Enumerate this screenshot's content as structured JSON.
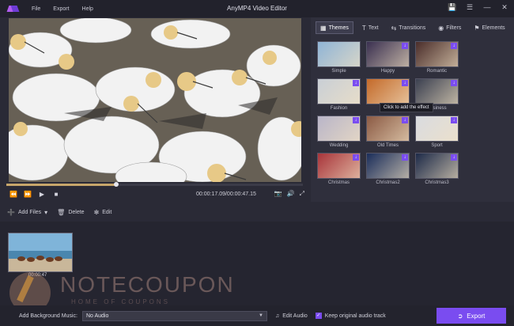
{
  "app": {
    "title": "AnyMP4 Video Editor",
    "menu": [
      "File",
      "Export",
      "Help"
    ],
    "window_controls": [
      "save-icon",
      "list-icon",
      "minimize-icon",
      "close-icon"
    ]
  },
  "player": {
    "time": "00:00:17.09/00:00:47.15",
    "progress": 0.37
  },
  "panel": {
    "tabs": [
      {
        "label": "Themes",
        "icon": "themes-icon",
        "active": true
      },
      {
        "label": "Text",
        "icon": "text-icon"
      },
      {
        "label": "Transitions",
        "icon": "transitions-icon"
      },
      {
        "label": "Filters",
        "icon": "filters-icon"
      },
      {
        "label": "Elements",
        "icon": "elements-icon"
      }
    ],
    "themes": [
      {
        "label": "Simple",
        "color": "#8fb4d6",
        "download": false
      },
      {
        "label": "Happy",
        "color": "#3a3050",
        "download": true
      },
      {
        "label": "Romantic",
        "color": "#4a2d2a",
        "download": true
      },
      {
        "label": "Fashion",
        "color": "#c9cfd6",
        "download": true
      },
      {
        "label": "",
        "color": "#c46a2a",
        "download": true
      },
      {
        "label": "Business",
        "color": "#3b4050",
        "download": true
      },
      {
        "label": "Wedding",
        "color": "#b9b5c8",
        "download": true
      },
      {
        "label": "Old Times",
        "color": "#8b5a44",
        "download": true
      },
      {
        "label": "Sport",
        "color": "#d9dbe0",
        "download": true
      },
      {
        "label": "Christmas",
        "color": "#a8343a",
        "download": true
      },
      {
        "label": "Christmas2",
        "color": "#1a2d5a",
        "download": true
      },
      {
        "label": "Christmas3",
        "color": "#1d2a48",
        "download": true
      }
    ],
    "tooltip": "Click to add the effect"
  },
  "toolbar": {
    "add_files": "Add Files",
    "delete": "Delete",
    "edit": "Edit"
  },
  "timeline": {
    "clip_duration": "00:00:47"
  },
  "watermark": {
    "text": "NOTECOUPON",
    "subtitle": "HOME OF COUPONS"
  },
  "bottom": {
    "bg_music_label": "Add Background Music:",
    "bg_music_value": "No Audio",
    "edit_audio": "Edit Audio",
    "keep_original": "Keep original audio track",
    "export": "Export"
  }
}
